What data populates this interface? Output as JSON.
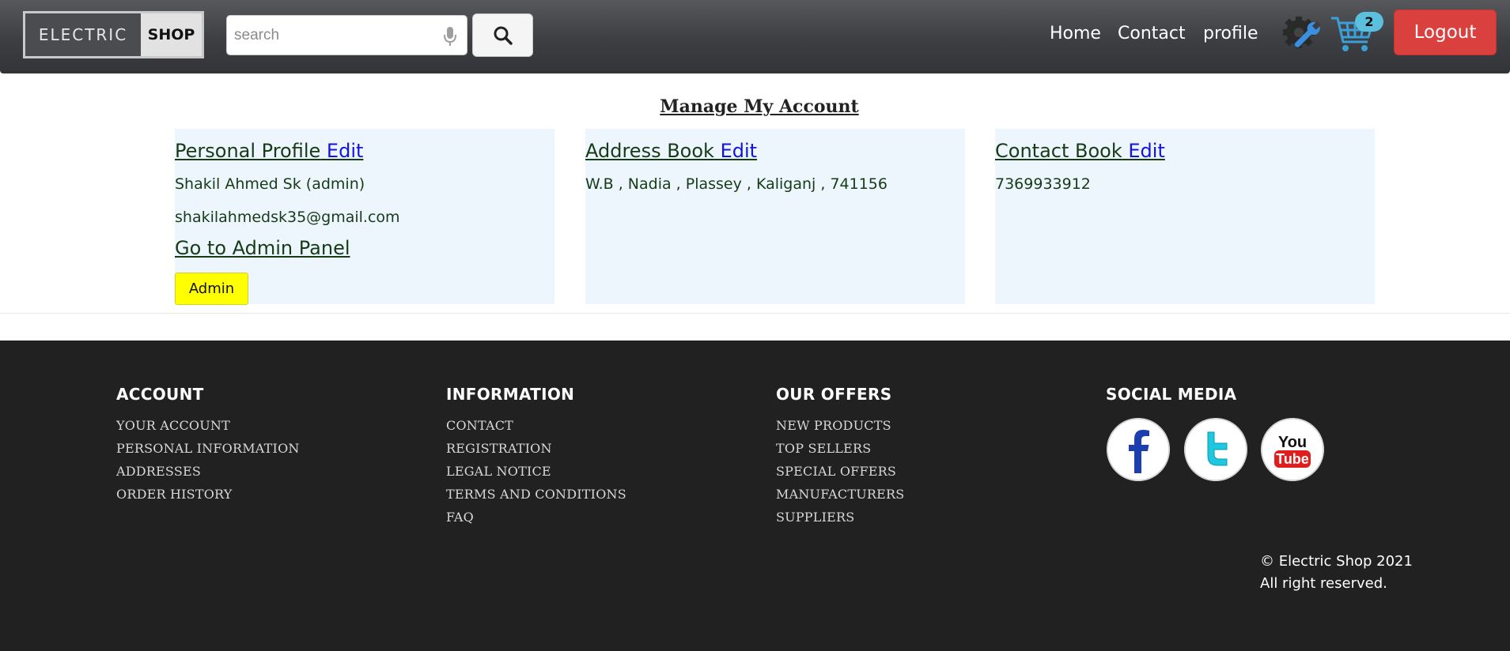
{
  "brand": {
    "part1": "ELECTRIC",
    "part2": "SHOP"
  },
  "search": {
    "placeholder": "search"
  },
  "nav": {
    "home": "Home",
    "contact": "Contact",
    "profile": "profile"
  },
  "cart": {
    "count": "2"
  },
  "logout_label": "Logout",
  "page_title": "Manage My Account",
  "personal_profile": {
    "heading": "Personal Profile",
    "edit": "Edit",
    "name": "Shakil Ahmed Sk (admin)",
    "email": "shakilahmedsk35@gmail.com",
    "admin_link": "Go to Admin Panel",
    "admin_button": "Admin"
  },
  "address_book": {
    "heading": "Address Book",
    "edit": "Edit",
    "address": "W.B , Nadia , Plassey , Kaliganj , 741156"
  },
  "contact_book": {
    "heading": "Contact Book",
    "edit": "Edit",
    "phone": "7369933912"
  },
  "footer": {
    "account": {
      "heading": "ACCOUNT",
      "links": [
        "YOUR ACCOUNT",
        "PERSONAL INFORMATION",
        "ADDRESSES",
        "ORDER HISTORY"
      ]
    },
    "information": {
      "heading": "INFORMATION",
      "links": [
        "CONTACT",
        "REGISTRATION",
        "LEGAL NOTICE",
        "TERMS AND CONDITIONS",
        "FAQ"
      ]
    },
    "offers": {
      "heading": "OUR OFFERS",
      "links": [
        "NEW PRODUCTS",
        "TOP SELLERS",
        "SPECIAL OFFERS",
        "MANUFACTURERS",
        "SUPPLIERS"
      ]
    },
    "social": {
      "heading": "SOCIAL MEDIA",
      "icons": [
        "facebook-icon",
        "twitter-icon",
        "youtube-icon"
      ]
    },
    "copyright_line1": "© Electric Shop 2021",
    "copyright_line2": "All right reserved."
  },
  "colors": {
    "navbar": "#3c3e42",
    "logout": "#d9403e",
    "cart": "#3aa0d8",
    "card_bg": "#edf6fd",
    "edit_link": "#1414e0",
    "admin_button": "#ffff00",
    "footer_bg": "#212121"
  }
}
